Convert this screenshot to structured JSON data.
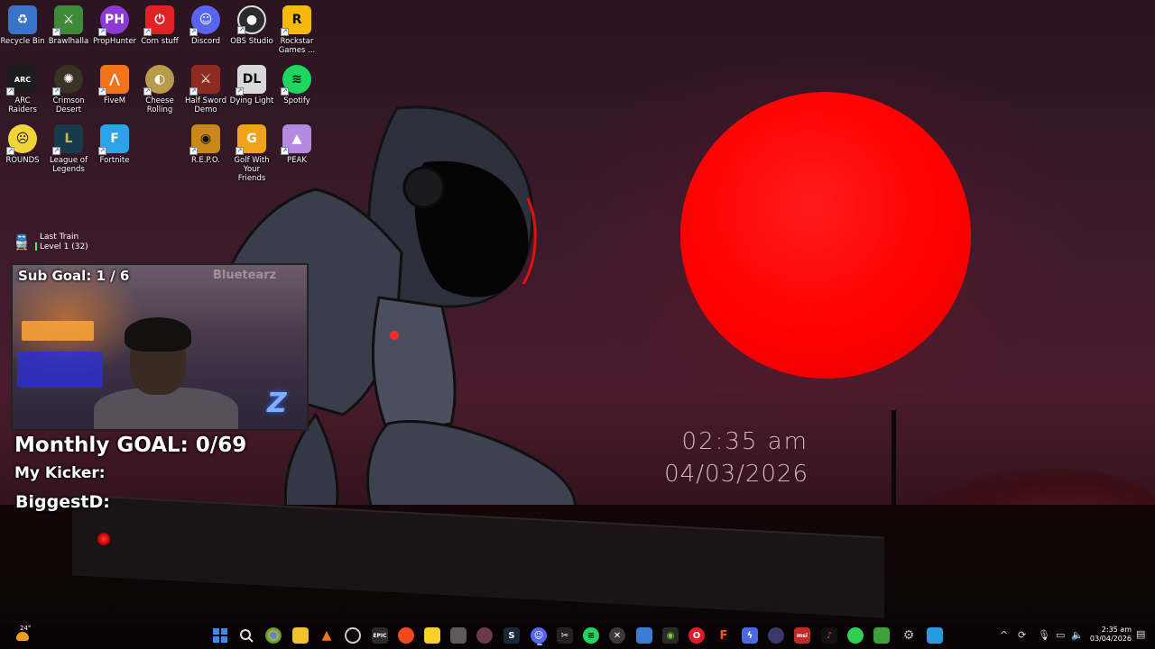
{
  "desktop_icons": [
    {
      "label": "Recycle Bin",
      "icon": "recycle-bin-icon",
      "color": "#3a73c8"
    },
    {
      "label": "Brawlhalla",
      "icon": "brawlhalla-icon",
      "color": "#3f8a3a"
    },
    {
      "label": "PropHunter",
      "icon": "prophunter-icon",
      "color": "#8c3ad6"
    },
    {
      "label": "Corn stuff",
      "icon": "power-icon",
      "color": "#e02222"
    },
    {
      "label": "Discord",
      "icon": "discord-icon",
      "color": "#5865f2"
    },
    {
      "label": "OBS Studio",
      "icon": "obs-icon",
      "color": "#2b2b2b"
    },
    {
      "label": "Rockstar Games ...",
      "icon": "rockstar-icon",
      "color": "#f6b80b"
    },
    {
      "label": "ARC Raiders",
      "icon": "arc-raiders-icon",
      "color": "#1d1d1d"
    },
    {
      "label": "Crimson Desert",
      "icon": "crimson-desert-icon",
      "color": "#3b3226"
    },
    {
      "label": "FiveM",
      "icon": "fivem-icon",
      "color": "#f2741a"
    },
    {
      "label": "Cheese Rolling",
      "icon": "cheese-rolling-icon",
      "color": "#b89c4c"
    },
    {
      "label": "Half Sword Demo",
      "icon": "half-sword-icon",
      "color": "#8e2a1f"
    },
    {
      "label": "Dying Light",
      "icon": "dying-light-icon",
      "color": "#d8d8d8"
    },
    {
      "label": "Spotify",
      "icon": "spotify-icon",
      "color": "#1ed760"
    },
    {
      "label": "ROUNDS",
      "icon": "rounds-icon",
      "color": "#f2d33a"
    },
    {
      "label": "League of Legends",
      "icon": "league-icon",
      "color": "#173b4a"
    },
    {
      "label": "Fortnite",
      "icon": "fortnite-icon",
      "color": "#2aa3e8"
    },
    {
      "label": "R.E.P.O.",
      "icon": "repo-icon",
      "color": "#c9871a"
    },
    {
      "label": "Golf With Your Friends",
      "icon": "golf-icon",
      "color": "#f0a21a"
    },
    {
      "label": "PEAK",
      "icon": "peak-icon",
      "color": "#b48ae0"
    }
  ],
  "wallpaper_clock": {
    "time": "02:35 am",
    "date": "04/03/2026"
  },
  "last_train": {
    "title": "Last Train",
    "level": "Level 1 (32)"
  },
  "stream_overlay": {
    "sub_goal": "Sub Goal:  1 / 6",
    "watermark": "Bluetearz",
    "monthly_goal": "Monthly GOAL: 0/69",
    "my_kicker": "My Kicker:",
    "biggest": "BiggestD:"
  },
  "weather": {
    "temp": "24°"
  },
  "taskbar_apps": [
    {
      "name": "start-icon",
      "color": "#3b8cff"
    },
    {
      "name": "search-icon",
      "color": "#dddddd"
    },
    {
      "name": "chrome-icon",
      "color": "#e8a31a"
    },
    {
      "name": "file-explorer-icon",
      "color": "#f2c12e"
    },
    {
      "name": "vlc-icon",
      "color": "#f07a12"
    },
    {
      "name": "obs-icon",
      "color": "#222222"
    },
    {
      "name": "epic-games-icon",
      "color": "#2a2a2a"
    },
    {
      "name": "brave-icon",
      "color": "#f04a1c"
    },
    {
      "name": "sticky-notes-icon",
      "color": "#f6d12a"
    },
    {
      "name": "snipping-tool-icon",
      "color": "#5a5a5a"
    },
    {
      "name": "pinned-game-icon",
      "color": "#6a3a4a"
    },
    {
      "name": "steam-icon",
      "color": "#1b2838"
    },
    {
      "name": "discord-icon",
      "color": "#5865f2"
    },
    {
      "name": "capcut-icon",
      "color": "#222222"
    },
    {
      "name": "spotify-icon",
      "color": "#1ed760"
    },
    {
      "name": "xbox-icon",
      "color": "#3a3a3a"
    },
    {
      "name": "photos-icon",
      "color": "#3a7bd6"
    },
    {
      "name": "nvidia-icon",
      "color": "#2a2a2a"
    },
    {
      "name": "opera-gx-icon",
      "color": "#e01a2a"
    },
    {
      "name": "faceit-icon",
      "color": "#ff5500"
    },
    {
      "name": "lightning-app-icon",
      "color": "#4a6ae0"
    },
    {
      "name": "settings-dial-icon",
      "color": "#3a3a6a"
    },
    {
      "name": "msi-icon",
      "color": "#c02a2a"
    },
    {
      "name": "tiktok-icon",
      "color": "#111111"
    },
    {
      "name": "chat-icon",
      "color": "#2fcf54"
    },
    {
      "name": "green-app-icon",
      "color": "#3fa03a"
    },
    {
      "name": "settings-icon",
      "color": "#7a7a7a"
    },
    {
      "name": "paint-icon",
      "color": "#2a9ae0"
    }
  ],
  "tray": {
    "time": "2:35 am",
    "date": "03/04/2026"
  }
}
